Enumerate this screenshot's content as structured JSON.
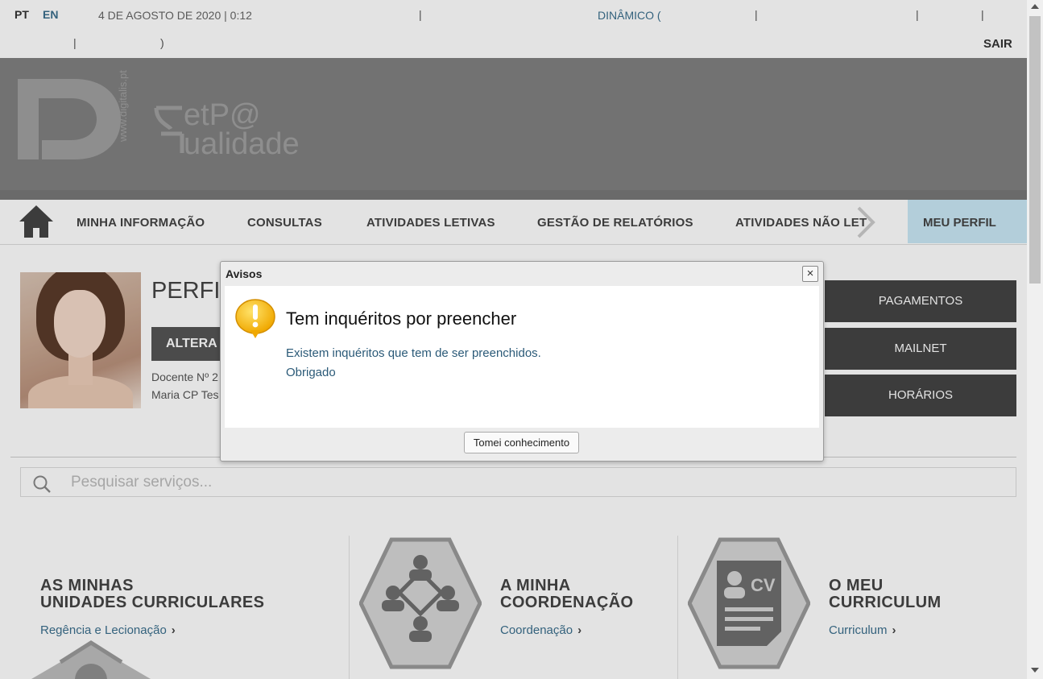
{
  "topbar": {
    "lang_pt": "PT",
    "lang_en": "EN",
    "date": "4 DE AGOSTO DE 2020 | 0:12",
    "sep": "|",
    "dynamic": "DINÂMICO (",
    "close_paren": ")",
    "logout": "SAIR"
  },
  "header": {
    "logo_site": "www.digitalis.pt",
    "logo_line1": "etP@",
    "logo_line2": "ualidade"
  },
  "nav": {
    "items": [
      "MINHA INFORMAÇÃO",
      "CONSULTAS",
      "ATIVIDADES LETIVAS",
      "GESTÃO DE RELATÓRIOS",
      "ATIVIDADES NÃO LET"
    ],
    "profile": "MEU PERFIL"
  },
  "profile": {
    "title": "PERFIL",
    "alter_button": "ALTERA",
    "role": "Docente Nº 2",
    "name": "Maria CP Tes"
  },
  "side_buttons": [
    "PAGAMENTOS",
    "MAILNET",
    "HORÁRIOS"
  ],
  "search": {
    "placeholder": "Pesquisar serviços..."
  },
  "tiles": [
    {
      "line1": "AS MINHAS",
      "line2": "UNIDADES CURRICULARES",
      "link": "Regência e Lecionação"
    },
    {
      "line1": "A MINHA",
      "line2": "COORDENAÇÃO",
      "link": "Coordenação"
    },
    {
      "line1": "O MEU",
      "line2": "CURRICULUM",
      "link": "Curriculum"
    }
  ],
  "dialog": {
    "title": "Avisos",
    "close": "×",
    "heading": "Tem inquéritos por preencher",
    "message_line1": "Existem inquéritos que tem de ser preenchidos.",
    "message_line2": "Obrigado",
    "ok_button": "Tomei conhecimento"
  },
  "colors": {
    "link": "#3b6f8d",
    "profile_tab": "#c9e8f5",
    "side_button": "#444444",
    "warning": "#f5b800"
  }
}
